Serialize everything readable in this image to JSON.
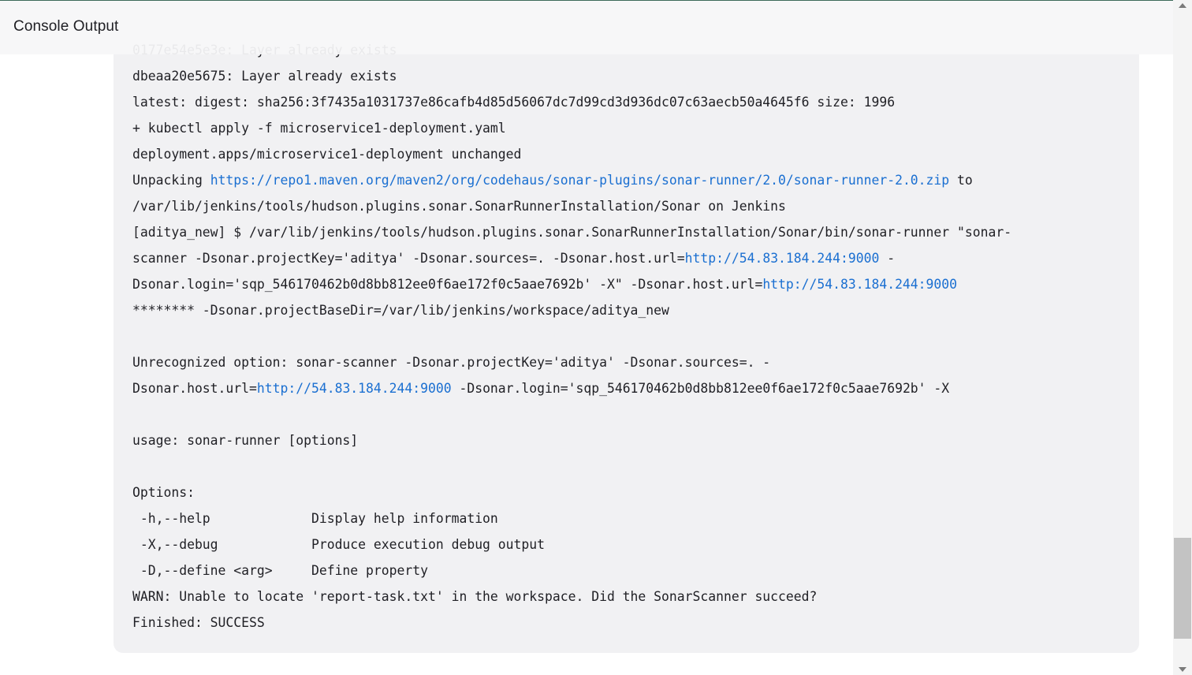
{
  "header": {
    "title": "Console Output"
  },
  "console": {
    "partial_top": "0177e54e5e3e: Layer already exists",
    "l1": "dbeaa20e5675: Layer already exists",
    "l2": "latest: digest: sha256:3f7435a1031737e86cafb4d85d56067dc7d99cd3d936dc07c63aecb50a4645f6 size: 1996",
    "l3": "+ kubectl apply -f microservice1-deployment.yaml",
    "l4": "deployment.apps/microservice1-deployment unchanged",
    "l5_pre": "Unpacking ",
    "l5_link": "https://repo1.maven.org/maven2/org/codehaus/sonar-plugins/sonar-runner/2.0/sonar-runner-2.0.zip",
    "l5_post": " to",
    "l6": "/var/lib/jenkins/tools/hudson.plugins.sonar.SonarRunnerInstallation/Sonar on Jenkins",
    "l7": "[aditya_new] $ /var/lib/jenkins/tools/hudson.plugins.sonar.SonarRunnerInstallation/Sonar/bin/sonar-runner \"sonar-",
    "l8_pre": "scanner -Dsonar.projectKey='aditya' -Dsonar.sources=. -Dsonar.host.url=",
    "l8_link": "http://54.83.184.244:9000",
    "l8_post": " -",
    "l9_pre": "Dsonar.login='sqp_546170462b0d8bb812ee0f6ae172f0c5aae7692b' -X\" -Dsonar.host.url=",
    "l9_link": "http://54.83.184.244:9000",
    "l10": "******** -Dsonar.projectBaseDir=/var/lib/jenkins/workspace/aditya_new",
    "l11": "Unrecognized option: sonar-scanner -Dsonar.projectKey='aditya' -Dsonar.sources=. -",
    "l12_pre": "Dsonar.host.url=",
    "l12_link": "http://54.83.184.244:9000",
    "l12_post": " -Dsonar.login='sqp_546170462b0d8bb812ee0f6ae172f0c5aae7692b' -X",
    "l13": "usage: sonar-runner [options]",
    "l14": "Options:",
    "l15": " -h,--help             Display help information",
    "l16": " -X,--debug            Produce execution debug output",
    "l17": " -D,--define <arg>     Define property",
    "l18": "WARN: Unable to locate 'report-task.txt' in the workspace. Did the SonarScanner succeed?",
    "l19": "Finished: SUCCESS"
  },
  "colors": {
    "link": "#1a6fd1",
    "text": "#1f1f24",
    "console_bg": "#f1f1f3"
  }
}
